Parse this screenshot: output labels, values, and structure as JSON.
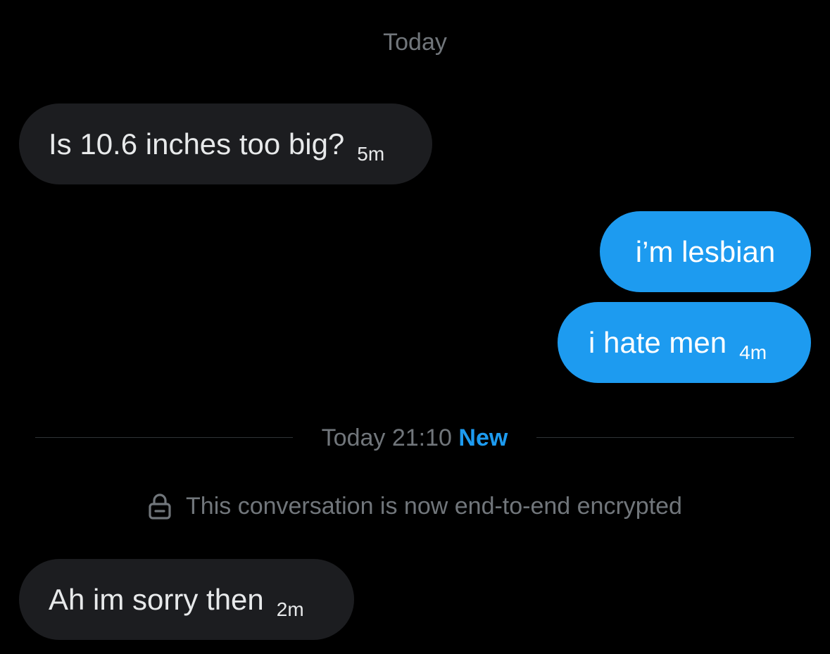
{
  "conversation": {
    "date_header": "Today",
    "messages": [
      {
        "text": "Is 10.6 inches too big?",
        "time": "5m",
        "direction": "incoming"
      },
      {
        "text": "i’m lesbian",
        "time": "",
        "direction": "outgoing"
      },
      {
        "text": "i hate men",
        "time": "4m",
        "direction": "outgoing"
      },
      {
        "text": "Ah im sorry then",
        "time": "2m",
        "direction": "incoming"
      }
    ],
    "divider": {
      "timestamp": "Today 21:10",
      "badge": "New"
    },
    "encryption_notice": {
      "icon": "lock-icon",
      "text": "This conversation is now end-to-end encrypted"
    }
  },
  "colors": {
    "background": "#000000",
    "incoming_bubble": "#1c1d20",
    "outgoing_bubble": "#1d9bf0",
    "secondary_text": "#71767b",
    "accent": "#1d9bf0"
  }
}
